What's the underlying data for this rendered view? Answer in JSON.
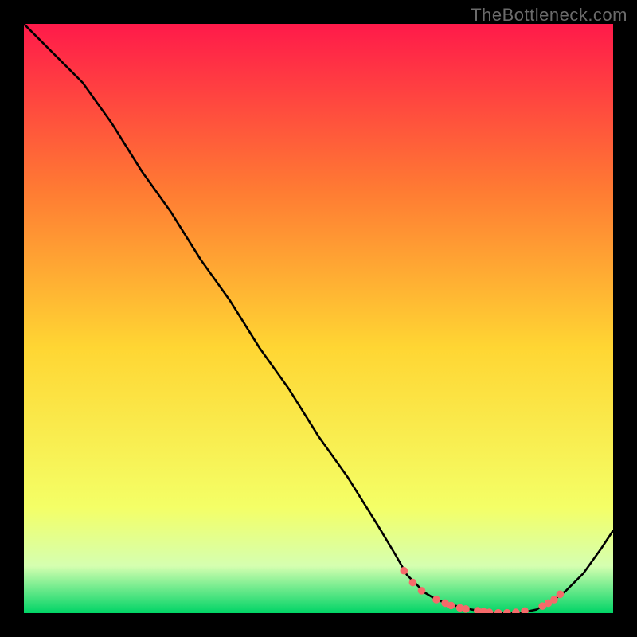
{
  "watermark": "TheBottleneck.com",
  "colors": {
    "background": "#000000",
    "line": "#000000",
    "marker": "#f66a6a",
    "gradient_top": "#ff1a4a",
    "gradient_mid_upper": "#ff7a33",
    "gradient_mid": "#ffd633",
    "gradient_mid_lower": "#f4ff66",
    "gradient_band": "#d5ffb0",
    "gradient_bottom": "#00d466"
  },
  "chart_data": {
    "type": "line",
    "title": "",
    "xlabel": "",
    "ylabel": "",
    "xlim": [
      0,
      100
    ],
    "ylim": [
      0,
      100
    ],
    "series": [
      {
        "name": "curve",
        "x": [
          0,
          8,
          10,
          15,
          20,
          25,
          30,
          35,
          40,
          45,
          50,
          55,
          60,
          63,
          65,
          68,
          70,
          73,
          76,
          80,
          84,
          87,
          88,
          90,
          92,
          95,
          98,
          100
        ],
        "y": [
          100,
          92,
          90,
          83,
          75,
          68,
          60,
          53,
          45,
          38,
          30,
          23,
          15,
          10,
          6.5,
          3.5,
          2.3,
          1.3,
          0.6,
          0,
          0,
          0.6,
          1.2,
          2.3,
          3.8,
          6.8,
          11,
          14
        ]
      }
    ],
    "markers": {
      "name": "near-zero-points",
      "x": [
        64.5,
        66,
        67.5,
        70,
        71.5,
        72.5,
        74,
        75,
        77,
        78,
        79,
        80.5,
        82,
        83.5,
        85,
        88,
        89,
        90,
        91
      ],
      "y": [
        7.2,
        5.2,
        3.8,
        2.3,
        1.7,
        1.3,
        0.9,
        0.7,
        0.4,
        0.25,
        0.12,
        0.05,
        0.05,
        0.12,
        0.35,
        1.2,
        1.7,
        2.3,
        3.2
      ]
    }
  }
}
